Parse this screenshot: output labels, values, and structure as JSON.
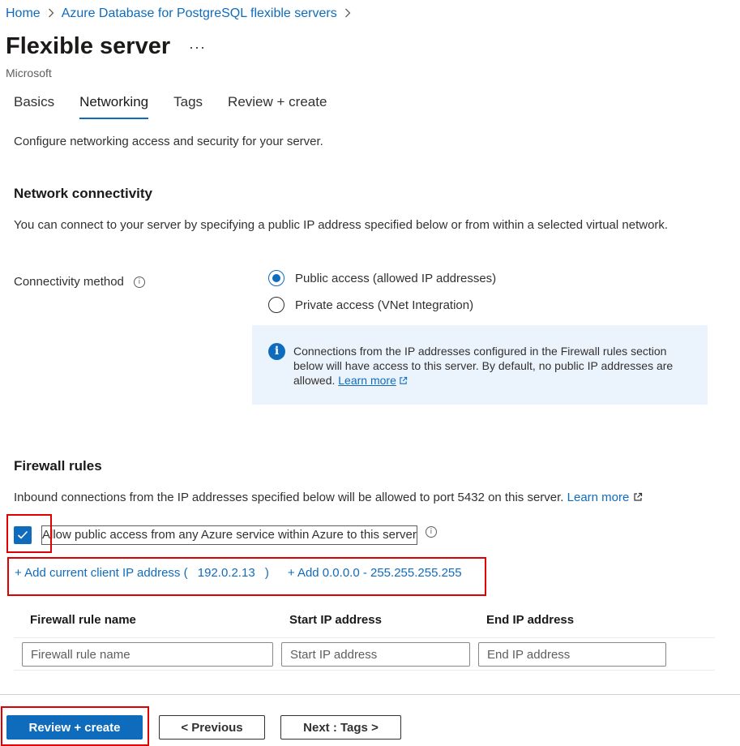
{
  "breadcrumb": {
    "home": "Home",
    "service": "Azure Database for PostgreSQL flexible servers"
  },
  "header": {
    "title": "Flexible server",
    "more": "···",
    "publisher": "Microsoft"
  },
  "tabs": [
    {
      "label": "Basics",
      "active": false
    },
    {
      "label": "Networking",
      "active": true
    },
    {
      "label": "Tags",
      "active": false
    },
    {
      "label": "Review + create",
      "active": false
    }
  ],
  "intro": "Configure networking access and security for your server.",
  "network": {
    "title": "Network connectivity",
    "description": "You can connect to your server by specifying a public IP address specified below or from within a selected virtual network.",
    "method_label": "Connectivity method",
    "options": [
      {
        "label": "Public access (allowed IP addresses)",
        "selected": true
      },
      {
        "label": "Private access (VNet Integration)",
        "selected": false
      }
    ],
    "info_text": "Connections from the IP addresses configured in the Firewall rules section below will have access to this server. By default, no public IP addresses are allowed.",
    "info_link": "Learn more"
  },
  "firewall": {
    "title": "Firewall rules",
    "description": "Inbound connections from the IP addresses specified below will be allowed to port 5432 on this server.",
    "learn_more": "Learn more",
    "allow_azure_label": "Allow public access from any Azure service within Azure to this server",
    "allow_azure_checked": true,
    "add_client_ip_prefix": "+ Add current client IP address (",
    "client_ip": "192.0.2.13",
    "add_client_ip_suffix": ")",
    "add_all_range": "+ Add 0.0.0.0 - 255.255.255.255",
    "columns": [
      "Firewall rule name",
      "Start IP address",
      "End IP address"
    ],
    "placeholders": {
      "name": "Firewall rule name",
      "start": "Start IP address",
      "end": "End IP address"
    }
  },
  "footer": {
    "review_create": "Review + create",
    "previous": "< Previous",
    "next": "Next : Tags >"
  },
  "colors": {
    "accent": "#0f6cbd",
    "highlight": "#e00000",
    "info_bg": "#ebf3fc"
  }
}
